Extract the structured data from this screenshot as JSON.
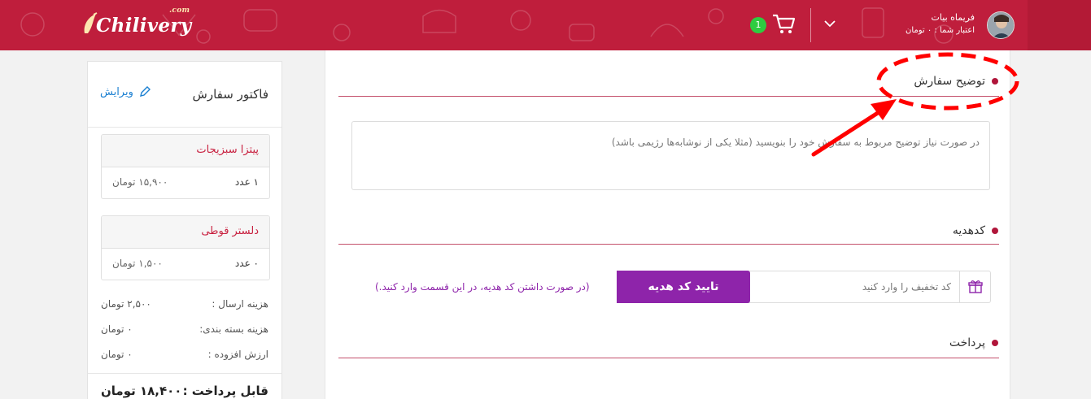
{
  "header": {
    "logo_text": "Chilivery",
    "logo_suffix": ".com",
    "cart_count": "1",
    "user_name": "فریماه بیات",
    "user_credit": "اعتبار شما : ۰ تومان",
    "brand_color": "#bf1e3c"
  },
  "invoice": {
    "title": "فاکتور سفارش",
    "edit_label": "ویرایش",
    "items": [
      {
        "name": "پیتزا سبزیجات",
        "qty": "۱ عدد",
        "price": "۱۵,۹۰۰ تومان"
      },
      {
        "name": "دلستر قوطی",
        "qty": "۰ عدد",
        "price": "۱,۵۰۰ تومان"
      }
    ],
    "fees": [
      {
        "label": "هزینه ارسال :",
        "value": "۲,۵۰۰ تومان"
      },
      {
        "label": "هزینه بسته بندی:",
        "value": "۰ تومان"
      },
      {
        "label": "ارزش افزوده :",
        "value": "۰ تومان"
      }
    ],
    "total_label": "قابل پرداخت :",
    "total_value": "۱۸,۴۰۰ تومان"
  },
  "main": {
    "description": {
      "title": "توضیح سفارش",
      "placeholder": "در صورت نیاز توضیح مربوط به سفارش خود را بنویسید (مثلا یکی از نوشابه‌ها رژیمی باشد)"
    },
    "gift": {
      "title": "کدهدیه",
      "input_placeholder": "کد تخفیف را وارد کنید",
      "button_label": "تایید کد هدیه",
      "hint": "(در صورت داشتن کد هدیه، در این قسمت وارد کنید.)"
    },
    "payment": {
      "title": "پرداخت"
    },
    "accent_color": "#b0153a",
    "button_color": "#8e24aa"
  },
  "annotation": {
    "color": "#ff0000",
    "target": "description-title"
  }
}
